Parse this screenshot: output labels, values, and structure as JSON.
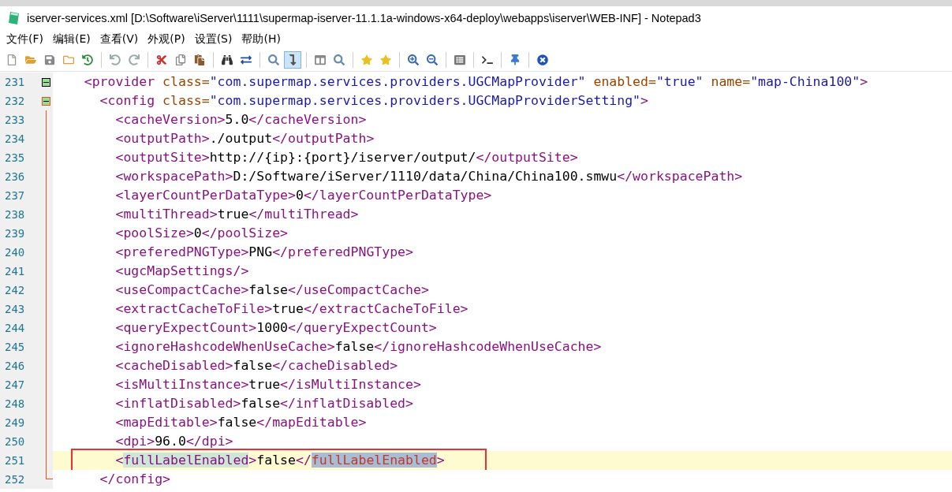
{
  "window": {
    "title": "iserver-services.xml [D:\\Software\\iServer\\1111\\supermap-iserver-11.1.1a-windows-x64-deploy\\webapps\\iserver\\WEB-INF] - Notepad3"
  },
  "menu": [
    "文件(F)",
    "编辑(E)",
    "查看(V)",
    "外观(P)",
    "设置(S)",
    "帮助(H)"
  ],
  "toolbar": [
    {
      "kind": "button",
      "selected": false
    },
    {
      "kind": "button",
      "selected": false
    },
    {
      "kind": "button",
      "selected": false
    },
    {
      "kind": "button",
      "selected": false
    },
    {
      "kind": "button",
      "selected": false
    },
    {
      "kind": "separator"
    },
    {
      "kind": "button",
      "selected": false
    },
    {
      "kind": "button",
      "selected": false
    },
    {
      "kind": "separator"
    },
    {
      "kind": "button",
      "selected": false
    },
    {
      "kind": "button",
      "selected": false
    },
    {
      "kind": "button",
      "selected": false
    },
    {
      "kind": "separator"
    },
    {
      "kind": "button",
      "selected": false
    },
    {
      "kind": "button",
      "selected": false
    },
    {
      "kind": "separator"
    },
    {
      "kind": "button",
      "selected": false
    },
    {
      "kind": "button",
      "selected": true
    },
    {
      "kind": "separator"
    },
    {
      "kind": "button",
      "selected": false
    },
    {
      "kind": "button",
      "selected": false
    },
    {
      "kind": "separator"
    },
    {
      "kind": "button",
      "selected": false
    },
    {
      "kind": "button",
      "selected": false
    },
    {
      "kind": "separator"
    },
    {
      "kind": "button",
      "selected": false
    },
    {
      "kind": "button",
      "selected": false
    },
    {
      "kind": "separator"
    },
    {
      "kind": "button",
      "selected": false
    },
    {
      "kind": "separator"
    },
    {
      "kind": "button",
      "selected": false
    },
    {
      "kind": "separator"
    },
    {
      "kind": "button",
      "selected": false
    },
    {
      "kind": "separator"
    },
    {
      "kind": "button",
      "selected": false
    }
  ],
  "editor": {
    "lines": [
      {
        "number": "231",
        "fold": true,
        "selected": false,
        "annotated": false,
        "segments": [
          {
            "kind": "tag",
            "text": "    <provider"
          },
          {
            "kind": "attr",
            "text": " class="
          },
          {
            "kind": "value",
            "text": "\"com.supermap.services.providers.UGCMapProvider\""
          },
          {
            "kind": "attr",
            "text": " enabled="
          },
          {
            "kind": "value",
            "text": "\"true\""
          },
          {
            "kind": "attr",
            "text": " name="
          },
          {
            "kind": "value",
            "text": "\"map-China100\""
          },
          {
            "kind": "tag",
            "text": ">"
          }
        ]
      },
      {
        "number": "232",
        "fold": true,
        "selected": false,
        "annotated": false,
        "segments": [
          {
            "kind": "tag",
            "text": "      <config"
          },
          {
            "kind": "attr",
            "text": " class="
          },
          {
            "kind": "value",
            "text": "\"com.supermap.services.providers.UGCMapProviderSetting\""
          },
          {
            "kind": "tag",
            "text": ">"
          }
        ]
      },
      {
        "number": "233",
        "fold": false,
        "selected": false,
        "annotated": false,
        "segments": [
          {
            "kind": "tag",
            "text": "        <cacheVersion>"
          },
          {
            "kind": "text",
            "text": "5.0"
          },
          {
            "kind": "tag",
            "text": "</cacheVersion>"
          }
        ]
      },
      {
        "number": "234",
        "fold": false,
        "selected": false,
        "annotated": false,
        "segments": [
          {
            "kind": "tag",
            "text": "        <outputPath>"
          },
          {
            "kind": "text",
            "text": "./output"
          },
          {
            "kind": "tag",
            "text": "</outputPath>"
          }
        ]
      },
      {
        "number": "235",
        "fold": false,
        "selected": false,
        "annotated": false,
        "segments": [
          {
            "kind": "tag",
            "text": "        <outputSite>"
          },
          {
            "kind": "text",
            "text": "http://{ip}:{port}/iserver/output/"
          },
          {
            "kind": "tag",
            "text": "</outputSite>"
          }
        ]
      },
      {
        "number": "236",
        "fold": false,
        "selected": false,
        "annotated": false,
        "segments": [
          {
            "kind": "tag",
            "text": "        <workspacePath>"
          },
          {
            "kind": "text",
            "text": "D:/Software/iServer/1110/data/China/China100.smwu"
          },
          {
            "kind": "tag",
            "text": "</workspacePath>"
          }
        ]
      },
      {
        "number": "237",
        "fold": false,
        "selected": false,
        "annotated": false,
        "segments": [
          {
            "kind": "tag",
            "text": "        <layerCountPerDataType>"
          },
          {
            "kind": "text",
            "text": "0"
          },
          {
            "kind": "tag",
            "text": "</layerCountPerDataType>"
          }
        ]
      },
      {
        "number": "238",
        "fold": false,
        "selected": false,
        "annotated": false,
        "segments": [
          {
            "kind": "tag",
            "text": "        <multiThread>"
          },
          {
            "kind": "text",
            "text": "true"
          },
          {
            "kind": "tag",
            "text": "</multiThread>"
          }
        ]
      },
      {
        "number": "239",
        "fold": false,
        "selected": false,
        "annotated": false,
        "segments": [
          {
            "kind": "tag",
            "text": "        <poolSize>"
          },
          {
            "kind": "text",
            "text": "0"
          },
          {
            "kind": "tag",
            "text": "</poolSize>"
          }
        ]
      },
      {
        "number": "240",
        "fold": false,
        "selected": false,
        "annotated": false,
        "segments": [
          {
            "kind": "tag",
            "text": "        <preferedPNGType>"
          },
          {
            "kind": "text",
            "text": "PNG"
          },
          {
            "kind": "tag",
            "text": "</preferedPNGType>"
          }
        ]
      },
      {
        "number": "241",
        "fold": false,
        "selected": false,
        "annotated": false,
        "segments": [
          {
            "kind": "tag",
            "text": "        <ugcMapSettings/>"
          }
        ]
      },
      {
        "number": "242",
        "fold": false,
        "selected": false,
        "annotated": false,
        "segments": [
          {
            "kind": "tag",
            "text": "        <useCompactCache>"
          },
          {
            "kind": "text",
            "text": "false"
          },
          {
            "kind": "tag",
            "text": "</useCompactCache>"
          }
        ]
      },
      {
        "number": "243",
        "fold": false,
        "selected": false,
        "annotated": false,
        "segments": [
          {
            "kind": "tag",
            "text": "        <extractCacheToFile>"
          },
          {
            "kind": "text",
            "text": "true"
          },
          {
            "kind": "tag",
            "text": "</extractCacheToFile>"
          }
        ]
      },
      {
        "number": "244",
        "fold": false,
        "selected": false,
        "annotated": false,
        "segments": [
          {
            "kind": "tag",
            "text": "        <queryExpectCount>"
          },
          {
            "kind": "text",
            "text": "1000"
          },
          {
            "kind": "tag",
            "text": "</queryExpectCount>"
          }
        ]
      },
      {
        "number": "245",
        "fold": false,
        "selected": false,
        "annotated": false,
        "segments": [
          {
            "kind": "tag",
            "text": "        <ignoreHashcodeWhenUseCache>"
          },
          {
            "kind": "text",
            "text": "false"
          },
          {
            "kind": "tag",
            "text": "</ignoreHashcodeWhenUseCache>"
          }
        ]
      },
      {
        "number": "246",
        "fold": false,
        "selected": false,
        "annotated": false,
        "segments": [
          {
            "kind": "tag",
            "text": "        <cacheDisabled>"
          },
          {
            "kind": "text",
            "text": "false"
          },
          {
            "kind": "tag",
            "text": "</cacheDisabled>"
          }
        ]
      },
      {
        "number": "247",
        "fold": false,
        "selected": false,
        "annotated": false,
        "segments": [
          {
            "kind": "tag",
            "text": "        <isMultiInstance>"
          },
          {
            "kind": "text",
            "text": "true"
          },
          {
            "kind": "tag",
            "text": "</isMultiInstance>"
          }
        ]
      },
      {
        "number": "248",
        "fold": false,
        "selected": false,
        "annotated": false,
        "segments": [
          {
            "kind": "tag",
            "text": "        <inflatDisabled>"
          },
          {
            "kind": "text",
            "text": "false"
          },
          {
            "kind": "tag",
            "text": "</inflatDisabled>"
          }
        ]
      },
      {
        "number": "249",
        "fold": false,
        "selected": false,
        "annotated": false,
        "segments": [
          {
            "kind": "tag",
            "text": "        <mapEditable>"
          },
          {
            "kind": "text",
            "text": "false"
          },
          {
            "kind": "tag",
            "text": "</mapEditable>"
          }
        ]
      },
      {
        "number": "250",
        "fold": false,
        "selected": false,
        "annotated": false,
        "segments": [
          {
            "kind": "tag",
            "text": "        <dpi>"
          },
          {
            "kind": "text",
            "text": "96.0"
          },
          {
            "kind": "tag",
            "text": "</dpi>"
          }
        ]
      },
      {
        "number": "251",
        "fold": false,
        "selected": true,
        "annotated": true,
        "segments": [
          {
            "kind": "tag",
            "text": "        <"
          },
          {
            "kind": "match",
            "text": "fullLabelEnabled"
          },
          {
            "kind": "tag",
            "text": ">"
          },
          {
            "kind": "text",
            "text": "false"
          },
          {
            "kind": "tag",
            "text": "</"
          },
          {
            "kind": "match-close",
            "text": "fullLabelEnabled"
          },
          {
            "kind": "tag",
            "text": ">"
          }
        ]
      },
      {
        "number": "252",
        "fold": false,
        "selected": false,
        "annotated": false,
        "segments": [
          {
            "kind": "tag",
            "text": "      </config>"
          }
        ]
      }
    ]
  }
}
